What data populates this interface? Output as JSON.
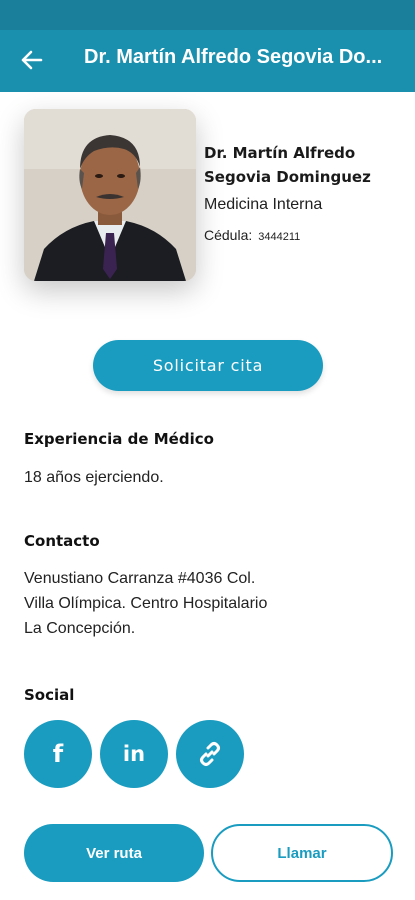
{
  "appbar": {
    "title": "Dr. Martín Alfredo Segovia Do...",
    "back_icon": "arrow-left-icon"
  },
  "doctor": {
    "name_line1": "Dr. Martín Alfredo",
    "name_line2": "Segovia Dominguez",
    "specialty": "Medicina Interna",
    "cedula_label": "Cédula:",
    "cedula_value": "3444211"
  },
  "actions": {
    "solicitar_label": "Solicitar cita",
    "ruta_label": "Ver ruta",
    "llamar_label": "Llamar"
  },
  "experience": {
    "heading": "Experiencia de Médico",
    "text": "18 años ejerciendo."
  },
  "contact": {
    "heading": "Contacto",
    "line1": "Venustiano Carranza #4036 Col.",
    "line2": "Villa Olímpica. Centro Hospitalario",
    "line3": "La Concepción."
  },
  "social": {
    "heading": "Social",
    "facebook_glyph": "f",
    "linkedin_glyph": "in",
    "icons": [
      "facebook-icon",
      "linkedin-icon",
      "link-icon"
    ]
  },
  "colors": {
    "primary": "#1a9cc0",
    "appbar": "#1a8fae"
  }
}
